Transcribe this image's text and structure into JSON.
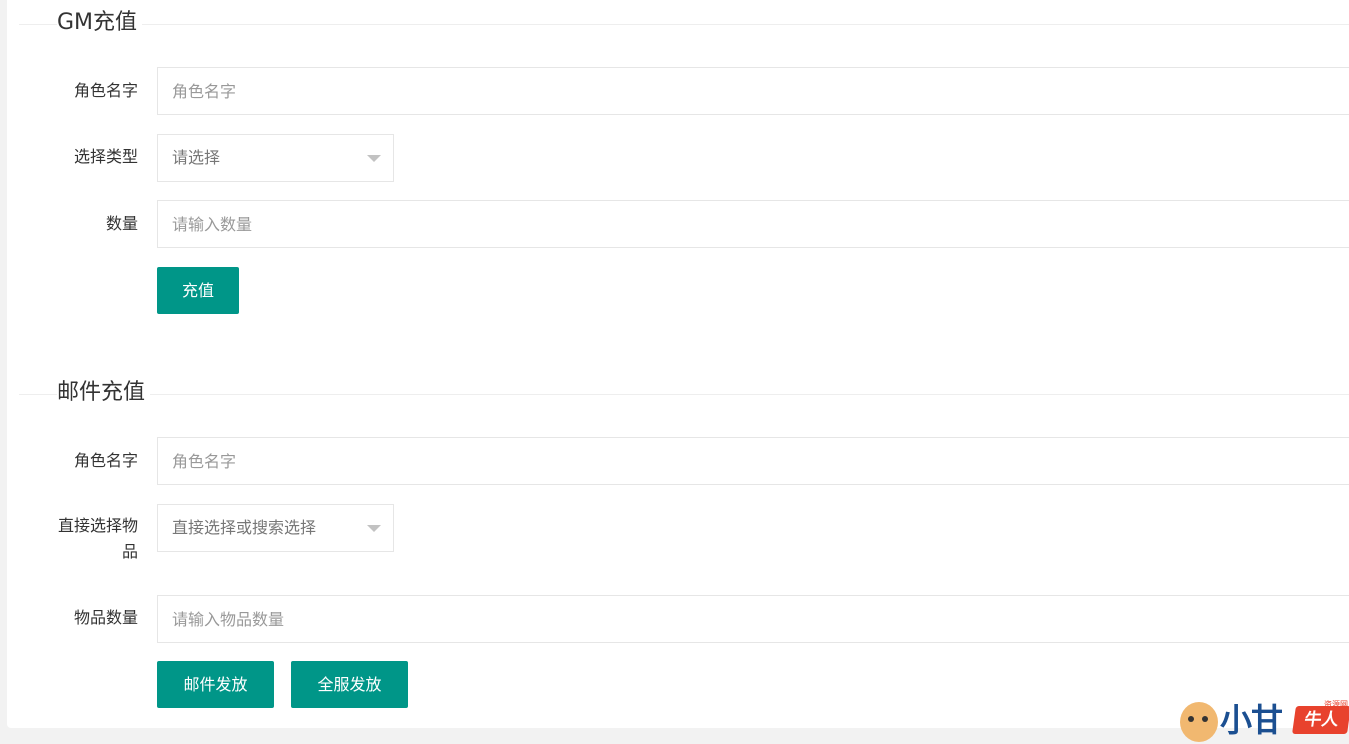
{
  "gm_section": {
    "title": "GM充值",
    "role_label": "角色名字",
    "role_placeholder": "角色名字",
    "type_label": "选择类型",
    "type_value": "请选择",
    "amount_label": "数量",
    "amount_placeholder": "请输入数量",
    "submit_label": "充值"
  },
  "mail_section": {
    "title": "邮件充值",
    "role_label": "角色名字",
    "role_placeholder": "角色名字",
    "item_label": "直接选择物品",
    "item_value": "直接选择或搜索选择",
    "item_count_label": "物品数量",
    "item_count_placeholder": "请输入物品数量",
    "mail_send_label": "邮件发放",
    "all_server_label": "全服发放"
  },
  "watermark": {
    "text": "小甘",
    "badge": "牛人",
    "small": "资源网"
  },
  "colors": {
    "primary": "#009688",
    "border": "#e6e6e6",
    "background": "#f2f2f2"
  }
}
